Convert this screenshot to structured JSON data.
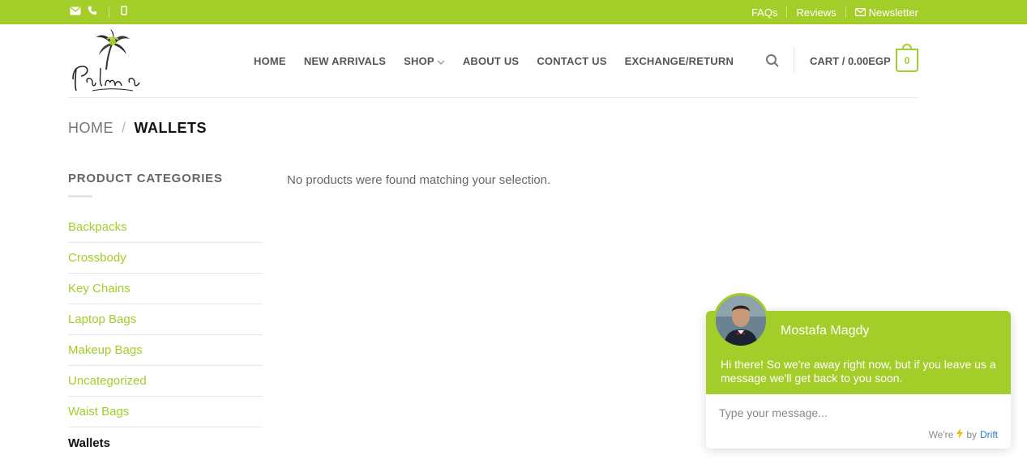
{
  "topbar": {
    "links": [
      {
        "label": "FAQs",
        "icon": ""
      },
      {
        "label": "Reviews",
        "icon": ""
      },
      {
        "label": "Newsletter",
        "icon": "envelope-icon"
      }
    ]
  },
  "nav": {
    "items": [
      {
        "label": "HOME"
      },
      {
        "label": "NEW ARRIVALS"
      },
      {
        "label": "SHOP",
        "icon": "chevron-down-icon"
      },
      {
        "label": "ABOUT US"
      },
      {
        "label": "CONTACT US"
      },
      {
        "label": "EXCHANGE/RETURN"
      }
    ]
  },
  "cart": {
    "label": "CART / 0.00EGP",
    "count": "0"
  },
  "breadcrumb": {
    "home": "HOME",
    "separator": "/",
    "current": "WALLETS"
  },
  "sidebar": {
    "title": "PRODUCT CATEGORIES",
    "categories": [
      {
        "label": "Backpacks"
      },
      {
        "label": "Crossbody"
      },
      {
        "label": "Key Chains"
      },
      {
        "label": "Laptop Bags"
      },
      {
        "label": "Makeup Bags"
      },
      {
        "label": "Uncategorized"
      },
      {
        "label": "Waist Bags"
      },
      {
        "label": "Wallets"
      }
    ]
  },
  "main": {
    "notice": "No products were found matching your selection."
  },
  "chat": {
    "name": "Mostafa Magdy",
    "message": "Hi there! So we're away right now, but if you leave us a message we'll get back to you soon.",
    "placeholder": "Type your message...",
    "brand_prefix": "We're",
    "brand_by": "by",
    "brand_name": "Drift"
  },
  "colors": {
    "accent": "#a3cd29",
    "link": "#2b79c8"
  }
}
